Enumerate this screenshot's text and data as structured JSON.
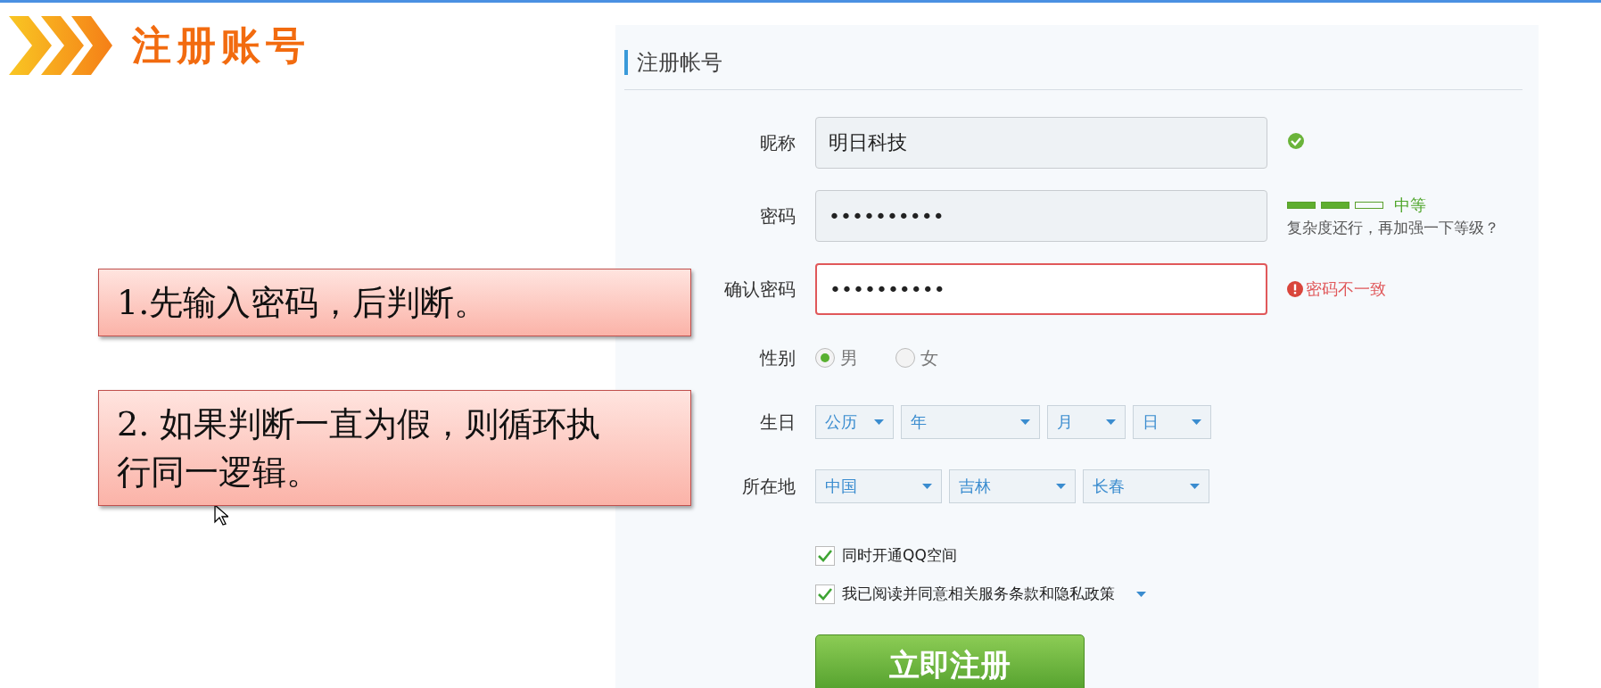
{
  "slide": {
    "title": "注册账号",
    "callouts": [
      "1.先输入密码，后判断。",
      "2. 如果判断一直为假，则循环执行同一逻辑。"
    ]
  },
  "form": {
    "heading": "注册帐号",
    "nickname": {
      "label": "昵称",
      "value": "明日科技",
      "valid": true
    },
    "password": {
      "label": "密码",
      "value": "••••••••••",
      "strength": {
        "level": 0.67,
        "rating": "中等",
        "hint": "复杂度还行，再加强一下等级？"
      }
    },
    "confirm": {
      "label": "确认密码",
      "value": "••••••••••",
      "error": "密码不一致"
    },
    "gender": {
      "label": "性别",
      "options": [
        {
          "label": "男",
          "selected": true
        },
        {
          "label": "女",
          "selected": false
        }
      ]
    },
    "birthday": {
      "label": "生日",
      "selects": [
        "公历",
        "年",
        "月",
        "日"
      ]
    },
    "location": {
      "label": "所在地",
      "selects": [
        "中国",
        "吉林",
        "长春"
      ]
    },
    "checkboxes": [
      {
        "label": "同时开通QQ空间",
        "checked": true,
        "dropdown": false
      },
      {
        "label": "我已阅读并同意相关服务条款和隐私政策",
        "checked": true,
        "dropdown": true
      }
    ],
    "submit": "立即注册"
  }
}
